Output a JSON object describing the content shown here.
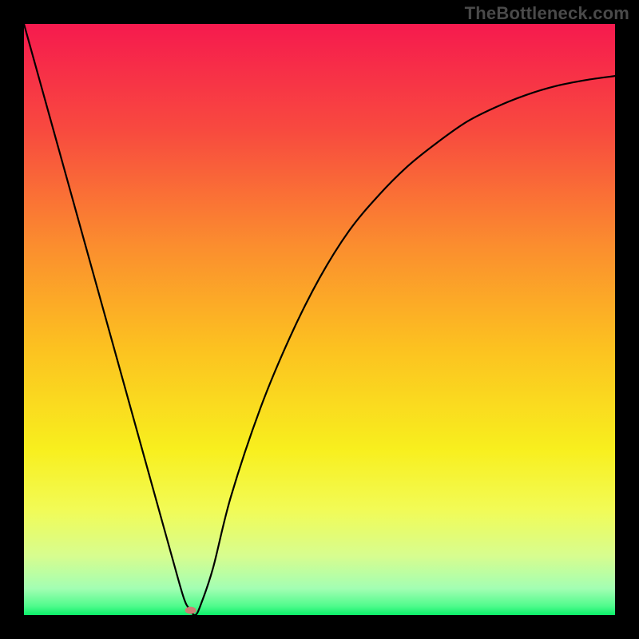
{
  "watermark": "TheBottleneck.com",
  "chart_data": {
    "type": "line",
    "title": "",
    "xlabel": "",
    "ylabel": "",
    "xlim": [
      0,
      100
    ],
    "ylim": [
      0,
      100
    ],
    "grid": false,
    "legend": false,
    "series": [
      {
        "name": "curve",
        "x": [
          0,
          5,
          10,
          15,
          20,
          25,
          27,
          28,
          29,
          30,
          32,
          35,
          40,
          45,
          50,
          55,
          60,
          65,
          70,
          75,
          80,
          85,
          90,
          95,
          100
        ],
        "y": [
          100,
          82,
          64,
          46,
          28,
          10,
          3,
          1,
          0,
          2,
          8,
          20,
          35,
          47,
          57,
          65,
          71,
          76,
          80,
          83.5,
          86,
          88,
          89.5,
          90.5,
          91.2
        ]
      }
    ],
    "marker": {
      "x": 28.2,
      "y": 0.8,
      "color": "#cf7c74",
      "rx": 7,
      "ry": 4.5
    },
    "background_gradient": {
      "stops": [
        {
          "pos": 0.0,
          "color": "#f61a4e"
        },
        {
          "pos": 0.18,
          "color": "#f84a3f"
        },
        {
          "pos": 0.38,
          "color": "#fb8f2e"
        },
        {
          "pos": 0.55,
          "color": "#fcc220"
        },
        {
          "pos": 0.72,
          "color": "#f8ef1e"
        },
        {
          "pos": 0.82,
          "color": "#f2fb55"
        },
        {
          "pos": 0.9,
          "color": "#d7fd8f"
        },
        {
          "pos": 0.955,
          "color": "#a3feb3"
        },
        {
          "pos": 0.985,
          "color": "#4ffb8c"
        },
        {
          "pos": 1.0,
          "color": "#0bef69"
        }
      ]
    }
  }
}
